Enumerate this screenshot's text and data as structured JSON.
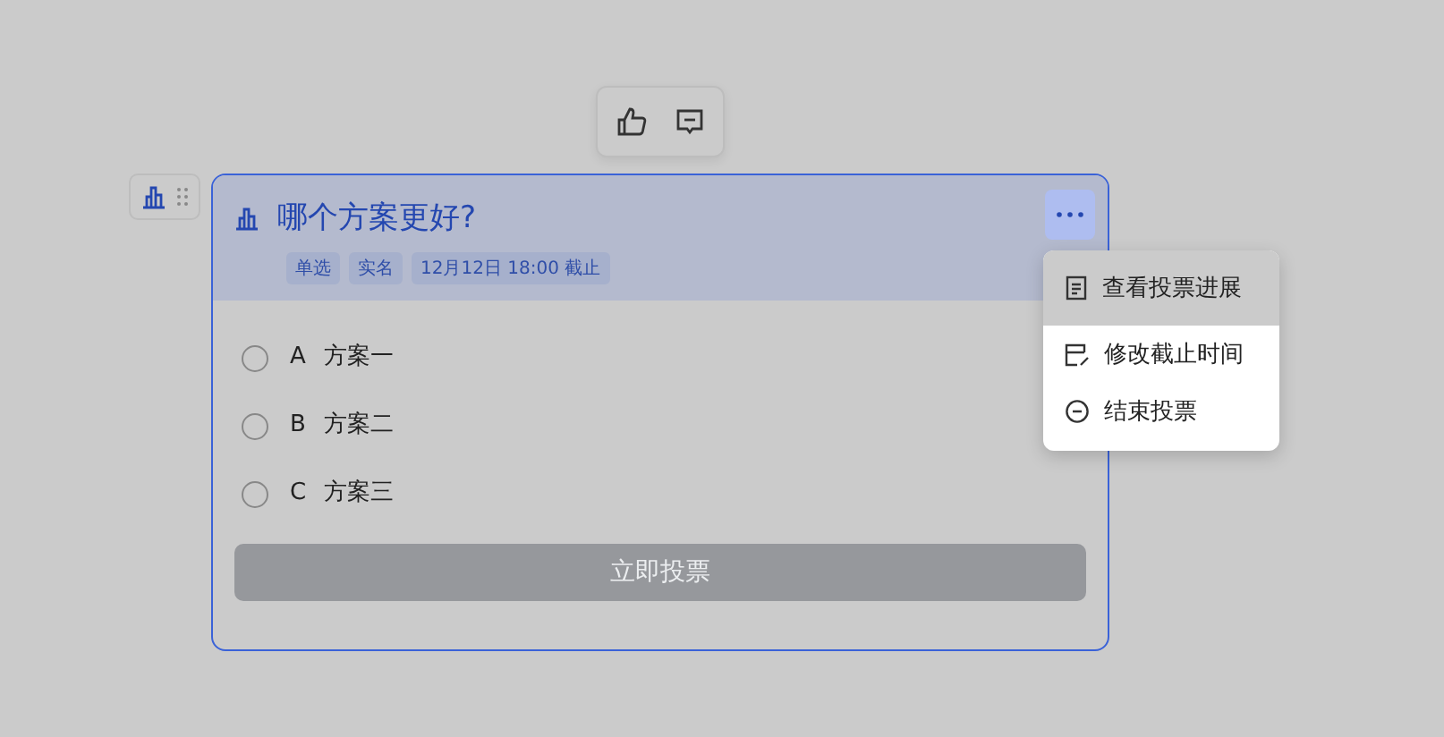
{
  "reaction_toolbar": {
    "buttons": [
      {
        "kind": "like"
      },
      {
        "kind": "comment"
      }
    ]
  },
  "poll": {
    "title": "哪个方案更好?",
    "tags": [
      "单选",
      "实名",
      "12月12日 18:00 截止"
    ],
    "options": [
      {
        "letter": "A",
        "label": "方案一",
        "selected": false
      },
      {
        "letter": "B",
        "label": "方案二",
        "selected": false
      },
      {
        "letter": "C",
        "label": "方案三",
        "selected": false
      }
    ],
    "vote_button": {
      "label": "立即投票",
      "disabled": true
    },
    "more_menu": {
      "open": true,
      "items": [
        {
          "kind": "progress",
          "label": "查看投票进展",
          "selected": true
        },
        {
          "kind": "deadline",
          "label": "修改截止时间",
          "selected": false
        },
        {
          "kind": "end",
          "label": "结束投票",
          "selected": false
        }
      ]
    }
  }
}
